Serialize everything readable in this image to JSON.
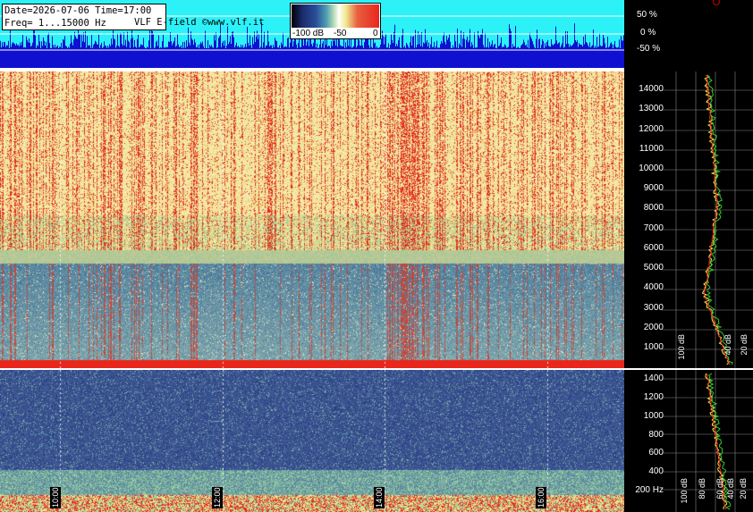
{
  "info": {
    "line1": "Date=2026-07-06 Time=17:00",
    "line2": "Freq= 1...15000 Hz",
    "credit": "VLF E-field ©www.vlf.it"
  },
  "colorbar": {
    "labels": [
      "-100 dB",
      "-50",
      "0"
    ]
  },
  "waveform_scale": [
    "50 %",
    "0 %",
    "-50 %"
  ],
  "freq_axis_high": [
    "14000",
    "13000",
    "12000",
    "11000",
    "10000",
    "9000",
    "8000",
    "7000",
    "6000",
    "5000",
    "4000",
    "3000",
    "2000",
    "1000"
  ],
  "freq_axis_low": [
    "1400",
    "1200",
    "1000",
    "800",
    "600",
    "400",
    "200 Hz"
  ],
  "profile_db_labels_high": [
    "100 dB",
    "40 dB",
    "20 dB"
  ],
  "profile_db_labels_low": [
    "100 dB",
    "80 dB",
    "60 dB",
    "40 dB",
    "20 dB"
  ],
  "time_labels": [
    "10:00",
    "12:00",
    "14:00",
    "16:00"
  ],
  "colors": {
    "cyan": "#2cf2f8",
    "wave": "#1010d0",
    "low_blue": "#2a3f8f",
    "red": "#e8261c",
    "yellow": "#f3e98b"
  },
  "chart_data": {
    "type": "heatmap",
    "title": "",
    "x": {
      "type": "time",
      "ticks": [
        "10:00",
        "12:00",
        "14:00",
        "16:00"
      ]
    },
    "y_upper": {
      "range": [
        1,
        15000
      ],
      "unit": "Hz",
      "ticks": [
        1000,
        2000,
        3000,
        4000,
        5000,
        6000,
        7000,
        8000,
        9000,
        10000,
        11000,
        12000,
        13000,
        14000
      ]
    },
    "y_lower": {
      "range": [
        1,
        1500
      ],
      "unit": "Hz",
      "ticks": [
        200,
        400,
        600,
        800,
        1000,
        1200,
        1400
      ]
    },
    "color_scale": {
      "min": -100,
      "max": 0,
      "unit": "dB",
      "ticks": [
        -100,
        -50,
        0
      ]
    },
    "waveform_scale": {
      "ticks": [
        50,
        0,
        -50
      ],
      "unit": "%"
    },
    "grid": true
  }
}
